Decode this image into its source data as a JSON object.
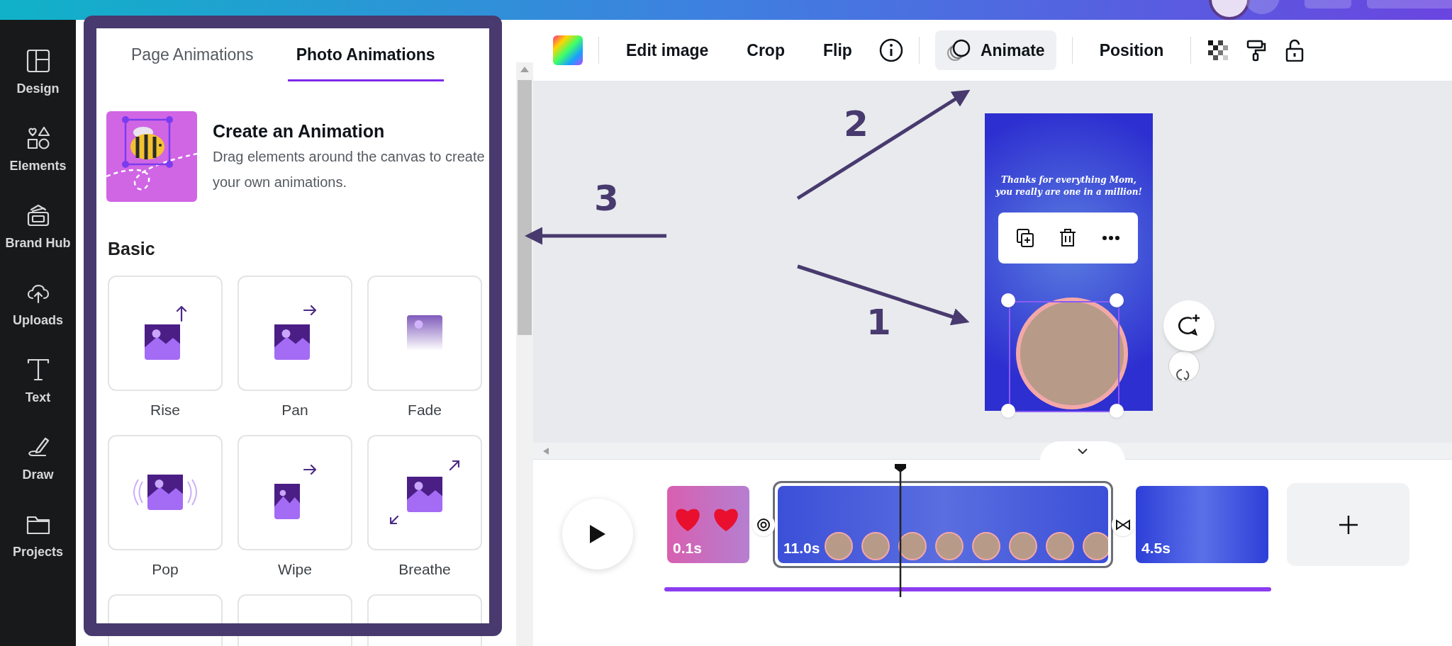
{
  "sidebar": {
    "items": [
      {
        "label": "Design",
        "kind": "design"
      },
      {
        "label": "Elements",
        "kind": "elements"
      },
      {
        "label": "Brand Hub",
        "kind": "brand"
      },
      {
        "label": "Uploads",
        "kind": "uploads"
      },
      {
        "label": "Text",
        "kind": "text"
      },
      {
        "label": "Draw",
        "kind": "draw"
      },
      {
        "label": "Projects",
        "kind": "projects"
      }
    ]
  },
  "panel": {
    "tabs": [
      {
        "label": "Page Animations",
        "selected": false
      },
      {
        "label": "Photo Animations",
        "selected": true
      }
    ],
    "promo": {
      "title": "Create an Animation",
      "description": "Drag elements around the canvas to create your own animations."
    },
    "section_title": "Basic",
    "animations": [
      {
        "label": "Rise",
        "kind": "rise"
      },
      {
        "label": "Pan",
        "kind": "pan"
      },
      {
        "label": "Fade",
        "kind": "fade"
      },
      {
        "label": "Pop",
        "kind": "pop"
      },
      {
        "label": "Wipe",
        "kind": "wipe"
      },
      {
        "label": "Breathe",
        "kind": "breathe"
      }
    ]
  },
  "toolbar": {
    "items": [
      {
        "kind": "color"
      },
      {
        "kind": "divider"
      },
      {
        "kind": "text",
        "label": "Edit image",
        "selected": false
      },
      {
        "kind": "text",
        "label": "Crop",
        "selected": false
      },
      {
        "kind": "text",
        "label": "Flip",
        "selected": false
      },
      {
        "kind": "info"
      },
      {
        "kind": "divider"
      },
      {
        "kind": "animate",
        "label": "Animate",
        "selected": true
      },
      {
        "kind": "divider"
      },
      {
        "kind": "text",
        "label": "Position",
        "selected": false
      },
      {
        "kind": "divider"
      },
      {
        "kind": "transparency"
      },
      {
        "kind": "paint"
      },
      {
        "kind": "lock"
      }
    ]
  },
  "canvas": {
    "page": {
      "message": "Thanks for everything Mom,\nyou really are one in a million!"
    }
  },
  "annotations": [
    {
      "label": "2"
    },
    {
      "label": "3"
    },
    {
      "label": "1"
    }
  ],
  "timeline": {
    "clips": [
      {
        "duration": "0.1s",
        "kind": "hearts",
        "selected": false
      },
      {
        "duration": "11.0s",
        "kind": "photo",
        "selected": true
      },
      {
        "duration": "4.5s",
        "kind": "mothers",
        "selected": false
      }
    ]
  }
}
